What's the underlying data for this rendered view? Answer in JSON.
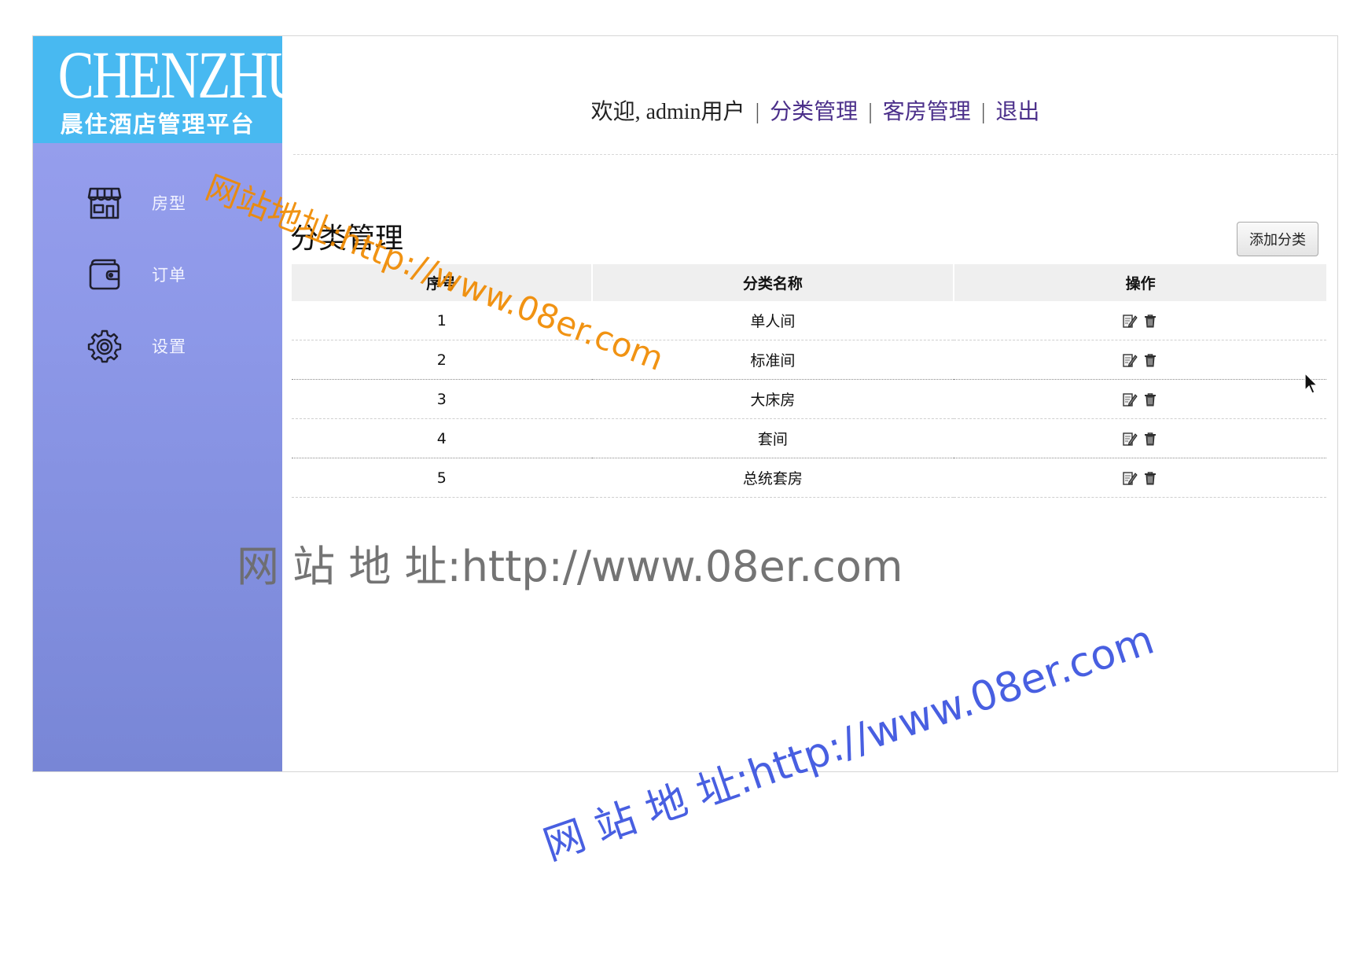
{
  "logo": {
    "title": "CHENZHU",
    "subtitle": "晨住酒店管理平台"
  },
  "sidebar": {
    "items": [
      {
        "label": "房型",
        "icon": "store-icon"
      },
      {
        "label": "订单",
        "icon": "wallet-icon"
      },
      {
        "label": "设置",
        "icon": "gear-icon"
      }
    ]
  },
  "header": {
    "welcome": "欢迎, admin用户",
    "separator": "|",
    "links": [
      "分类管理",
      "客房管理",
      "退出"
    ]
  },
  "page": {
    "title": "分类管理",
    "add_button": "添加分类"
  },
  "table": {
    "headers": [
      "序号",
      "分类名称",
      "操作"
    ],
    "rows": [
      {
        "index": "1",
        "name": "单人间"
      },
      {
        "index": "2",
        "name": "标准间"
      },
      {
        "index": "3",
        "name": "大床房"
      },
      {
        "index": "4",
        "name": "套间"
      },
      {
        "index": "5",
        "name": "总统套房"
      }
    ],
    "actions": {
      "edit_icon": "edit-icon",
      "delete_icon": "trash-icon"
    }
  },
  "watermarks": [
    "网站地址:http://www.08er.com",
    "网 站 地 址:http://www.08er.com",
    "网 站 地 址:http://www.08er.com"
  ],
  "colors": {
    "logo_bg": "#48b9f1",
    "sidebar_top": "#9aa1ef",
    "sidebar_bottom": "#7886d6",
    "link": "#4b2f8a",
    "table_header_bg": "#efefef"
  }
}
